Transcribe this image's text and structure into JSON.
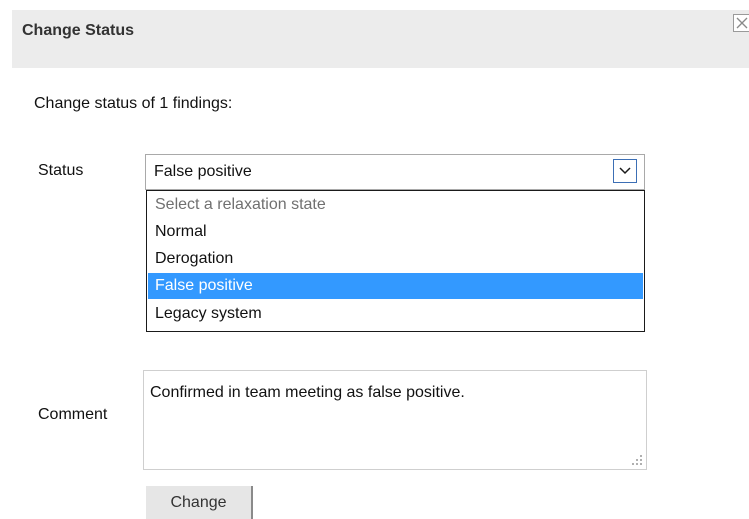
{
  "dialog": {
    "title": "Change Status",
    "intro": "Change status of 1 findings:",
    "status_label": "Status",
    "comment_label": "Comment",
    "submit_label": "Change"
  },
  "status_select": {
    "value": "False positive",
    "options": [
      "Select a relaxation state",
      "Normal",
      "Derogation",
      "False positive",
      "Legacy system"
    ],
    "selected_index": 3
  },
  "comment": {
    "value": "Confirmed in team meeting as false positive."
  },
  "colors": {
    "header_bg": "#ececec",
    "highlight": "#3399ff",
    "button_bg": "#e6e6e6"
  },
  "icons": {
    "close": "close-icon",
    "dropdown": "chevron-down-icon",
    "resize": "resize-grip-icon"
  }
}
